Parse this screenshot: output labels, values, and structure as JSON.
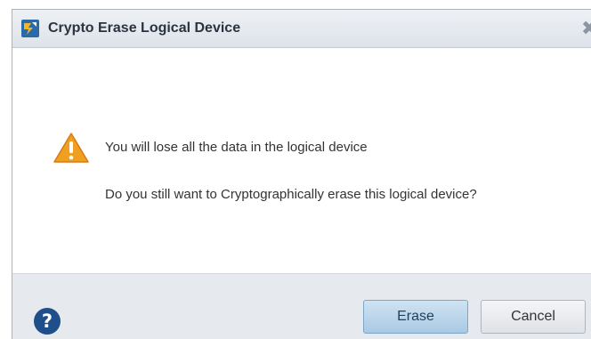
{
  "dialog": {
    "title": "Crypto Erase Logical Device",
    "close_glyph": "✖",
    "app_icon": "app-logo-icon",
    "warning_icon": "warning-triangle-icon",
    "message_primary": "You will lose all the data in the logical device",
    "message_secondary": "Do you still want to Cryptographically erase this logical device?"
  },
  "footer": {
    "help_icon": "help-question-icon",
    "erase_label": "Erase",
    "cancel_label": "Cancel"
  },
  "colors": {
    "warning": "#f0a020",
    "help": "#1f4f8a",
    "primary_button": "#a9c9e3"
  }
}
